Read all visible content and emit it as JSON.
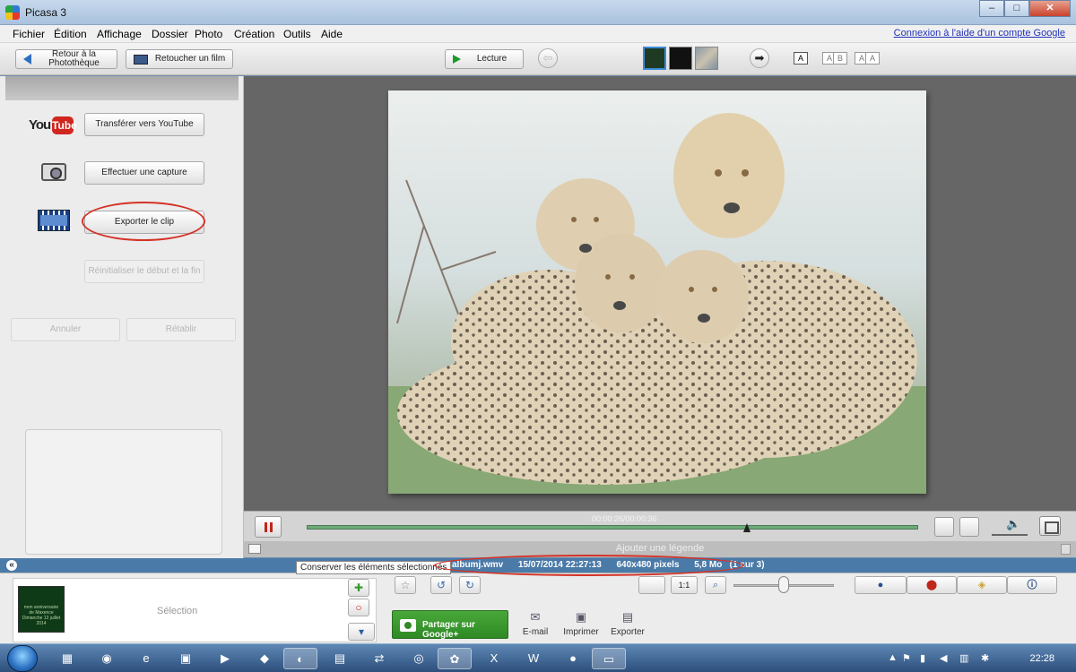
{
  "window": {
    "title": "Picasa 3",
    "min": "–",
    "max": "□",
    "close": "✕"
  },
  "menu": [
    "Fichier",
    "Édition",
    "Affichage",
    "Dossier",
    "Photo",
    "Création",
    "Outils",
    "Aide"
  ],
  "google_link": "Connexion à l'aide d'un compte Google",
  "toolbar": {
    "back_label": "Retour à la Photothèque",
    "retouch_label": "Retoucher un film",
    "play_label": "Lecture",
    "text_buttons": [
      "A",
      "A",
      "A",
      "B",
      "A",
      "A"
    ]
  },
  "left": {
    "youtube_you": "You",
    "youtube_tube": "Tube",
    "upload_youtube": "Transférer vers YouTube",
    "capture": "Effectuer une capture",
    "export_clip": "Exporter le clip",
    "reset": "Réinitialiser le début et la fin",
    "undo": "Annuler",
    "redo": "Rétablir"
  },
  "player": {
    "time": "00:00:26/00:00:36",
    "progress_fraction": 0.72
  },
  "caption_placeholder": "Ajouter une légende",
  "status": {
    "tooltip": "Conserver les éléments sélectionnés",
    "filename": "albumj.wmv",
    "date": "15/07/2014 22:27:13",
    "dimensions": "640x480 pixels",
    "size": "5,8 Mo",
    "position": "(1 sur 3)"
  },
  "tray": {
    "thumb_caption": "mon anniversaire de Maxence Dimanche 13 juillet 2014",
    "selection_label": "Sélection",
    "share_label": "Partager sur Google+",
    "email": "E-mail",
    "print": "Imprimer",
    "export": "Exporter",
    "zoom_1to1": "1:1"
  },
  "taskbar": {
    "time": "22:28"
  },
  "colors": {
    "accent_red": "#d43226",
    "status_blue": "#4a7aa8",
    "share_green": "#3a9a2e"
  }
}
